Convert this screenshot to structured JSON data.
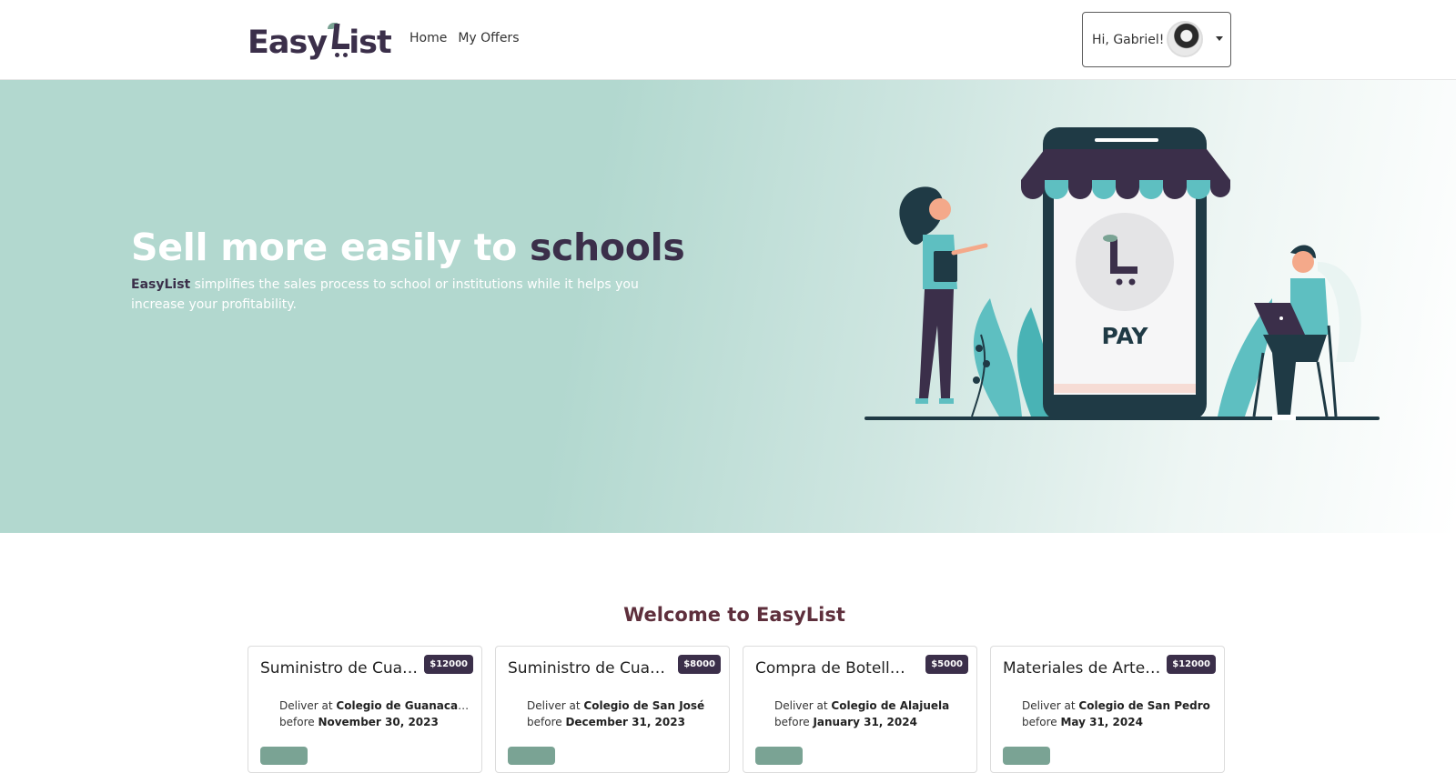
{
  "navbar": {
    "logo_text_left": "Easy",
    "logo_text_right": "ist",
    "links": [
      {
        "label": "Home"
      },
      {
        "label": "My Offers"
      }
    ],
    "user_greeting": "Hi, Gabriel!"
  },
  "hero": {
    "title_plain": "Sell more easily to ",
    "title_accent": "schools",
    "subtitle_brand": "EasyList",
    "subtitle_rest": " simplifies the sales process to school or institutions while it helps you increase your profitability.",
    "illustration_label": "PAY"
  },
  "welcome": "Welcome to EasyList",
  "cards": [
    {
      "title": "Suministro de Cuadernos",
      "price": "$12000",
      "deliver_prefix": "Deliver at ",
      "location": "Colegio de Guanacaste",
      "before_prefix": "before ",
      "date": "November 30, 2023"
    },
    {
      "title": "Suministro de Cuadernos",
      "price": "$8000",
      "deliver_prefix": "Deliver at ",
      "location": "Colegio de San José",
      "before_prefix": "before ",
      "date": "December 31, 2023"
    },
    {
      "title": "Compra de Botellas de Agua",
      "price": "$5000",
      "deliver_prefix": "Deliver at ",
      "location": "Colegio de Alajuela",
      "before_prefix": "before ",
      "date": "January 31, 2024"
    },
    {
      "title": "Materiales de Arte Escolar",
      "price": "$12000",
      "deliver_prefix": "Deliver at ",
      "location": "Colegio de San Pedro",
      "before_prefix": "before ",
      "date": "May 31, 2024"
    }
  ],
  "colors": {
    "brand_dark": "#3b2f4a",
    "brand_green": "#7aa394",
    "hero_bg": "#b2d8cf",
    "welcome": "#5e2f3c"
  }
}
